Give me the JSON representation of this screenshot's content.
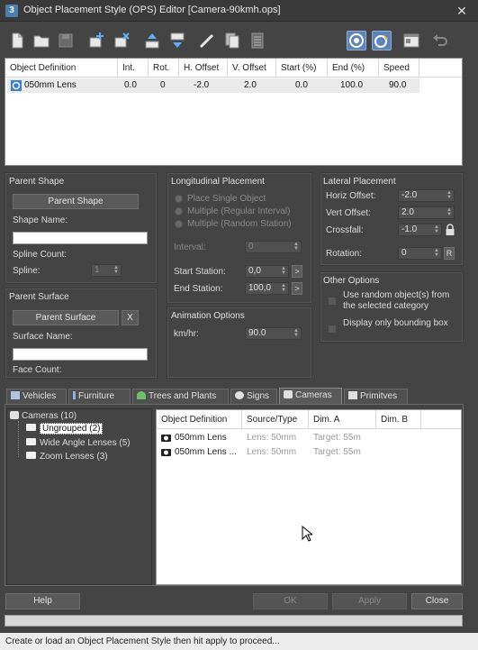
{
  "window": {
    "app_icon_text": "3",
    "title": "Object Placement Style (OPS) Editor [Camera-90kmh.ops]",
    "close_glyph": "✕"
  },
  "toolbar": {
    "buttons": [
      "new-icon",
      "open-folder-icon",
      "save-icon",
      "add-object-icon",
      "delete-object-icon",
      "move-up-icon",
      "move-down-icon",
      "pick-spline-icon",
      "copy-icon",
      "list-icon",
      "target-icon",
      "pick-target-icon",
      "settings-window-icon",
      "undo-icon"
    ]
  },
  "main_list": {
    "columns": [
      "Object Definition",
      "Int.",
      "Rot.",
      "H. Offset",
      "V. Offset",
      "Start (%)",
      "End (%)",
      "Speed"
    ],
    "rows": [
      {
        "name": "050mm Lens",
        "int": "0.0",
        "rot": "0",
        "h_offset": "-2.0",
        "v_offset": "2.0",
        "start": "0.0",
        "end": "100.0",
        "speed": "90.0"
      }
    ]
  },
  "parent_shape": {
    "title": "Parent Shape",
    "button": "Parent Shape",
    "shape_name_label": "Shape Name:",
    "spline_count_label": "Spline Count:",
    "spline_label": "Spline:",
    "spline_value": "1"
  },
  "parent_surface": {
    "title": "Parent Surface",
    "button": "Parent Surface",
    "x_button": "X",
    "surface_name_label": "Surface Name:",
    "face_count_label": "Face Count:"
  },
  "longitudinal": {
    "title": "Longitudinal Placement",
    "radio_single": "Place Single Object",
    "radio_regular": "Multiple (Regular Interval)",
    "radio_random": "Multiple (Random Station)",
    "interval_label": "Interval:",
    "interval_value": "0",
    "start_label": "Start Station:",
    "start_value": "0,0",
    "end_label": "End Station:",
    "end_value": "100,0",
    "arrow_btn": ">"
  },
  "animation": {
    "title": "Animation Options",
    "kmhr_label": "km/hr:",
    "kmhr_value": "90.0"
  },
  "lateral": {
    "title": "Lateral Placement",
    "horiz_label": "Horiz Offset:",
    "horiz_value": "-2.0",
    "vert_label": "Vert Offset:",
    "vert_value": "2.0",
    "crossfall_label": "Crossfall:",
    "crossfall_value": "-1.0",
    "rotation_label": "Rotation:",
    "rotation_value": "0",
    "r_button": "R"
  },
  "other": {
    "title": "Other Options",
    "random_label_1": "Use random object(s) from",
    "random_label_2": "the selected category",
    "bbox_label": "Display only bounding box"
  },
  "tabs": [
    "Vehicles",
    "Furniture",
    "Trees and Plants",
    "Signs",
    "Cameras",
    "Primitves"
  ],
  "active_tab": "Cameras",
  "tree": {
    "root": "Cameras (10)",
    "children": [
      "Ungrouped (2)",
      "Wide Angle Lenses (5)",
      "Zoom Lenses (3)"
    ]
  },
  "library_list": {
    "columns": [
      "Object Definition",
      "Source/Type",
      "Dim. A",
      "Dim. B"
    ],
    "rows": [
      {
        "name": "050mm Lens",
        "source": "Lens: 50mm",
        "dim_a": "Target: 55m",
        "dim_b": ""
      },
      {
        "name": "050mm Lens ...",
        "source": "Lens: 50mm",
        "dim_a": "Target: 55m",
        "dim_b": ""
      }
    ]
  },
  "footer": {
    "help": "Help",
    "ok": "OK",
    "apply": "Apply",
    "close": "Close"
  },
  "status": "Create or load an Object Placement Style then hit apply to proceed..."
}
